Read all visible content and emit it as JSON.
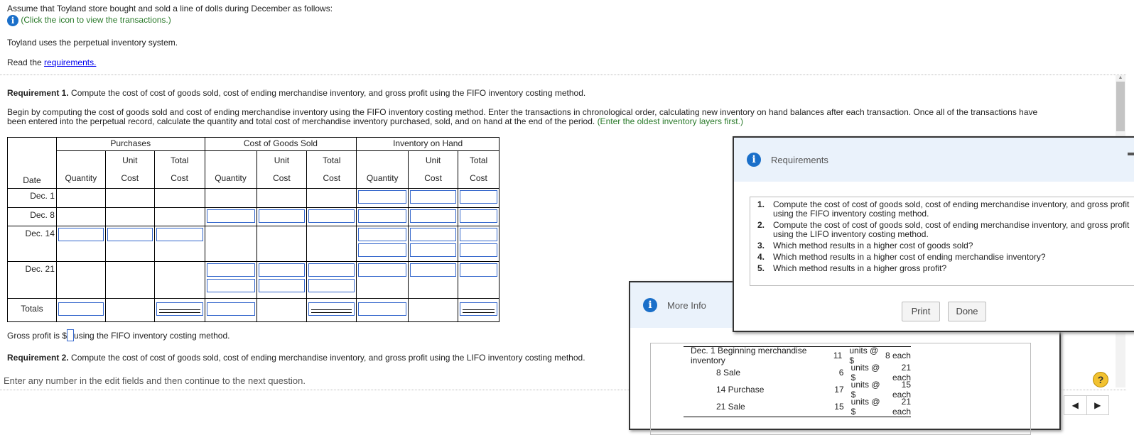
{
  "intro": {
    "line1": "Assume that Toyland store bought and sold a line of dolls during December as follows:",
    "click_icon": "(Click the icon to view the transactions.)",
    "line2": "Toyland uses the perpetual inventory system.",
    "read_prefix": "Read the ",
    "read_link": "requirements."
  },
  "req1": {
    "label": "Requirement 1.",
    "text": " Compute the cost of cost of goods sold, cost of ending merchandise inventory, and gross profit using the FIFO inventory costing method.",
    "instructions": "Begin by computing the cost of goods sold and cost of ending merchandise inventory using the FIFO inventory costing method. Enter the transactions in chronological order, calculating new inventory on hand balances after each transaction. Once all of the transactions have been entered into the perpetual record, calculate the quantity and total cost of merchandise inventory purchased, sold, and on hand at the end of the period. ",
    "hint": "(Enter the oldest inventory layers first.)"
  },
  "table": {
    "groups": [
      "Purchases",
      "Cost of Goods Sold",
      "Inventory on Hand"
    ],
    "date_header": "Date",
    "sub_top": [
      "",
      "Unit",
      "Total"
    ],
    "sub_bottom": [
      "Quantity",
      "Cost",
      "Cost"
    ],
    "rows": [
      "Dec. 1",
      "Dec. 8",
      "Dec. 14",
      "Dec. 21"
    ],
    "totals": "Totals"
  },
  "gross": {
    "prefix": "Gross profit is $",
    "suffix": " using the FIFO inventory costing method."
  },
  "req2": {
    "label": "Requirement 2.",
    "text": " Compute the cost of cost of goods sold, cost of ending merchandise inventory, and gross profit using the LIFO inventory costing method."
  },
  "footer": "Enter any number in the edit fields and then continue to the next question.",
  "requirements_dialog": {
    "title": "Requirements",
    "items": [
      {
        "n": "1.",
        "t": "Compute the cost of cost of goods sold, cost of ending merchandise inventory, and gross profit using the FIFO inventory costing method."
      },
      {
        "n": "2.",
        "t": "Compute the cost of cost of goods sold, cost of ending merchandise inventory, and gross profit using the LIFO inventory costing method."
      },
      {
        "n": "3.",
        "t": "Which method results in a higher cost of goods sold?"
      },
      {
        "n": "4.",
        "t": "Which method results in a higher cost of ending merchandise inventory?"
      },
      {
        "n": "5.",
        "t": "Which method results in a higher gross profit?"
      }
    ],
    "print": "Print",
    "done": "Done"
  },
  "more_info": {
    "title": "More Info",
    "transactions": [
      {
        "desc": "Dec. 1 Beginning merchandise inventory",
        "qty": "11",
        "units": "units @ $",
        "price": "8 each"
      },
      {
        "desc": "8 Sale",
        "qty": "6",
        "units": "units @ $",
        "price": "21 each"
      },
      {
        "desc": "14 Purchase",
        "qty": "17",
        "units": "units @ $",
        "price": "15 each"
      },
      {
        "desc": "21 Sale",
        "qty": "15",
        "units": "units @ $",
        "price": "21 each"
      }
    ]
  },
  "help": "?"
}
